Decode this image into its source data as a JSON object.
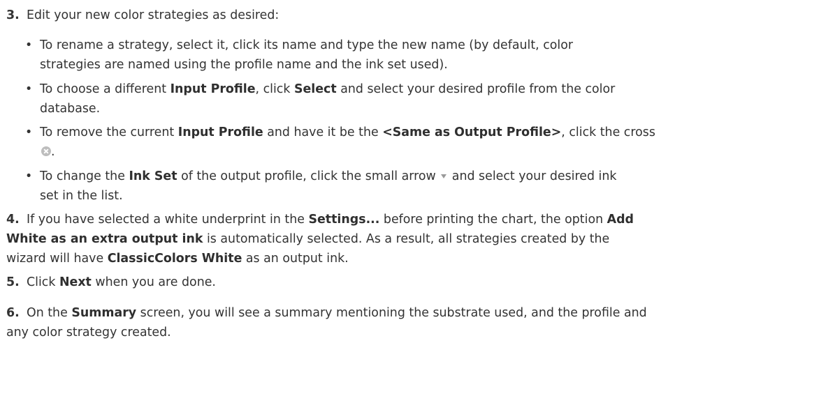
{
  "steps": [
    {
      "number": "3.",
      "text": "Edit your new color strategies as desired:",
      "bullets": [
        {
          "lines": [
            [
              "To rename a strategy, select it, click its name and type the new name (by default, color"
            ],
            [
              "strategies are named using the profile name and the ink set used)."
            ]
          ]
        },
        {
          "line1_a": "To choose a different ",
          "line1_b": "Input Profile",
          "line1_c": ", click ",
          "line1_d": "Select",
          "line1_e": " and select your desired profile from the color",
          "line2": "database."
        },
        {
          "line1_a": "To remove the current ",
          "line1_b": "Input Profile",
          "line1_c": " and have it be the ",
          "line1_d": "<Same as Output Profile>",
          "line1_e": ", click the cross",
          "line2_end": "."
        },
        {
          "line1_a": "To change the ",
          "line1_b": "Ink Set",
          "line1_c": " of the output profile, click the small arrow",
          "line1_d": " and select your desired ink",
          "line2": "set in the list."
        }
      ]
    },
    {
      "number": "4.",
      "line1_a": "If you have selected a white underprint in the ",
      "line1_b": "Settings...",
      "line1_c": " before printing the chart, the option ",
      "line1_d": "Add",
      "line2_a": "White as an extra output ink",
      "line2_b": " is automatically selected. As a result, all strategies created by the",
      "line3_a": "wizard will have ",
      "line3_b": "ClassicColors White",
      "line3_c": " as an output ink."
    },
    {
      "number": "5.",
      "line1_a": "Click ",
      "line1_b": "Next",
      "line1_c": " when you are done."
    },
    {
      "number": "6.",
      "line1_a": "On the ",
      "line1_b": "Summary",
      "line1_c": " screen, you will see a summary mentioning the substrate used, and the profile and",
      "line2": "any color strategy created."
    }
  ],
  "bullet_char": "•",
  "icons": {
    "cross": "cross-circle-icon",
    "arrow": "dropdown-arrow-icon"
  }
}
